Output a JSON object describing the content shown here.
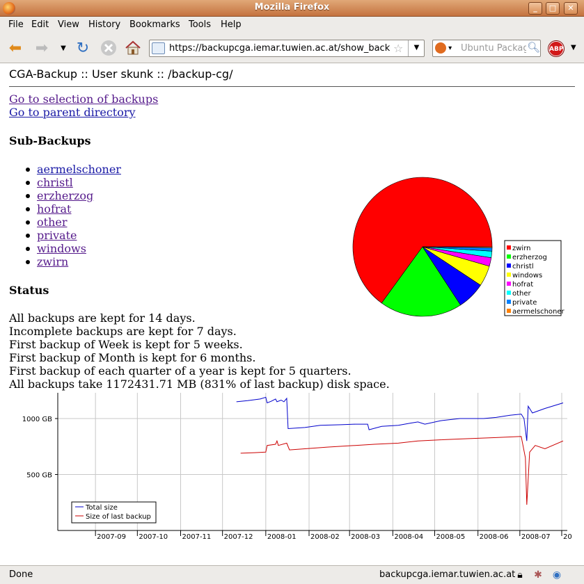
{
  "window": {
    "title": "Mozilla Firefox"
  },
  "menu": {
    "items": [
      "File",
      "Edit",
      "View",
      "History",
      "Bookmarks",
      "Tools",
      "Help"
    ]
  },
  "toolbar": {
    "url": "https://backupcga.iemar.tuwien.ac.at/show_backu",
    "search_placeholder": "Ubuntu Packag",
    "icons": [
      "back-icon",
      "forward-icon",
      "history-dropdown-icon",
      "reload-icon",
      "stop-icon",
      "home-icon",
      "site-identity-icon",
      "bookmark-star-icon",
      "search-engine-icon",
      "search-icon",
      "adblock-icon"
    ],
    "abp_label": "ABP"
  },
  "page": {
    "heading": "CGA-Backup :: User skunk :: /backup-cg/",
    "links": [
      "Go to selection of backups",
      "Go to parent directory"
    ],
    "sub_title": "Sub-Backups",
    "sub_backups": [
      "aermelschoner",
      "christl",
      "erzherzog",
      "hofrat",
      "other",
      "private",
      "windows",
      "zwirn"
    ],
    "status_title": "Status",
    "status_lines": [
      "All backups are kept for 14 days.",
      "Incomplete backups are kept for 7 days.",
      "First backup of Week is kept for 5 weeks.",
      "First backup of Month is kept for 6 months.",
      "First backup of each quarter of a year is kept for 5 quarters.",
      "All backups take 1172431.71 MB (831% of last backup) disk space."
    ]
  },
  "chart_data": [
    {
      "type": "pie",
      "legend_position": "right",
      "series": [
        {
          "name": "zwirn",
          "value": 65.0,
          "color": "#ff0000"
        },
        {
          "name": "erzherzog",
          "value": 19.2,
          "color": "#00ff00"
        },
        {
          "name": "christl",
          "value": 6.5,
          "color": "#0000ff"
        },
        {
          "name": "windows",
          "value": 4.8,
          "color": "#ffff00"
        },
        {
          "name": "hofrat",
          "value": 2.0,
          "color": "#ff00ff"
        },
        {
          "name": "other",
          "value": 1.5,
          "color": "#00ffff"
        },
        {
          "name": "private",
          "value": 0.8,
          "color": "#0080ff"
        },
        {
          "name": "aermelschoner",
          "value": 0.2,
          "color": "#ff8000"
        }
      ]
    },
    {
      "type": "line",
      "legend_position": "bottom-left",
      "grid": true,
      "ylim": [
        0,
        1230
      ],
      "yticks": [
        {
          "label": "500 GB",
          "value": 500
        },
        {
          "label": "1000 GB",
          "value": 1000
        }
      ],
      "xlim": [
        "2007-08-01",
        "2008-07-31"
      ],
      "xticks": [
        "2007-09",
        "2007-10",
        "2007-11",
        "2007-12",
        "2008-01",
        "2008-02",
        "2008-03",
        "2008-04",
        "2008-05",
        "2008-06",
        "2008-07",
        "20"
      ],
      "series": [
        {
          "name": "Total size",
          "color": "#0000cc",
          "points": [
            [
              "2007-12-07",
              1150
            ],
            [
              "2007-12-15",
              1160
            ],
            [
              "2007-12-24",
              1175
            ],
            [
              "2007-12-28",
              1190
            ],
            [
              "2007-12-29",
              1140
            ],
            [
              "2008-01-01",
              1155
            ],
            [
              "2008-01-04",
              1175
            ],
            [
              "2008-01-05",
              1150
            ],
            [
              "2008-01-08",
              1165
            ],
            [
              "2008-01-10",
              1150
            ],
            [
              "2008-01-12",
              1180
            ],
            [
              "2008-01-13",
              910
            ],
            [
              "2008-01-25",
              920
            ],
            [
              "2008-02-05",
              940
            ],
            [
              "2008-02-20",
              945
            ],
            [
              "2008-03-01",
              950
            ],
            [
              "2008-03-10",
              950
            ],
            [
              "2008-03-11",
              900
            ],
            [
              "2008-03-20",
              930
            ],
            [
              "2008-04-01",
              940
            ],
            [
              "2008-04-10",
              960
            ],
            [
              "2008-04-15",
              970
            ],
            [
              "2008-04-20",
              950
            ],
            [
              "2008-05-01",
              980
            ],
            [
              "2008-05-15",
              1000
            ],
            [
              "2008-06-01",
              1000
            ],
            [
              "2008-06-10",
              1010
            ],
            [
              "2008-06-20",
              1030
            ],
            [
              "2008-06-28",
              1040
            ],
            [
              "2008-06-30",
              1000
            ],
            [
              "2008-07-02",
              800
            ],
            [
              "2008-07-03",
              1110
            ],
            [
              "2008-07-06",
              1050
            ],
            [
              "2008-07-15",
              1090
            ],
            [
              "2008-07-28",
              1140
            ]
          ]
        },
        {
          "name": "Size of last backup",
          "color": "#cc0000",
          "points": [
            [
              "2007-12-10",
              690
            ],
            [
              "2007-12-20",
              695
            ],
            [
              "2007-12-28",
              700
            ],
            [
              "2007-12-29",
              760
            ],
            [
              "2008-01-04",
              770
            ],
            [
              "2008-01-05",
              800
            ],
            [
              "2008-01-06",
              760
            ],
            [
              "2008-01-12",
              780
            ],
            [
              "2008-01-14",
              720
            ],
            [
              "2008-01-25",
              730
            ],
            [
              "2008-02-10",
              745
            ],
            [
              "2008-03-01",
              760
            ],
            [
              "2008-03-15",
              770
            ],
            [
              "2008-04-01",
              780
            ],
            [
              "2008-04-15",
              800
            ],
            [
              "2008-05-01",
              810
            ],
            [
              "2008-05-20",
              820
            ],
            [
              "2008-06-10",
              830
            ],
            [
              "2008-06-28",
              840
            ],
            [
              "2008-07-01",
              650
            ],
            [
              "2008-07-02",
              230
            ],
            [
              "2008-07-04",
              700
            ],
            [
              "2008-07-08",
              760
            ],
            [
              "2008-07-15",
              730
            ],
            [
              "2008-07-28",
              800
            ]
          ]
        }
      ]
    }
  ],
  "statusbar": {
    "left": "Done",
    "host": "backupcga.iemar.tuwien.ac.at"
  }
}
